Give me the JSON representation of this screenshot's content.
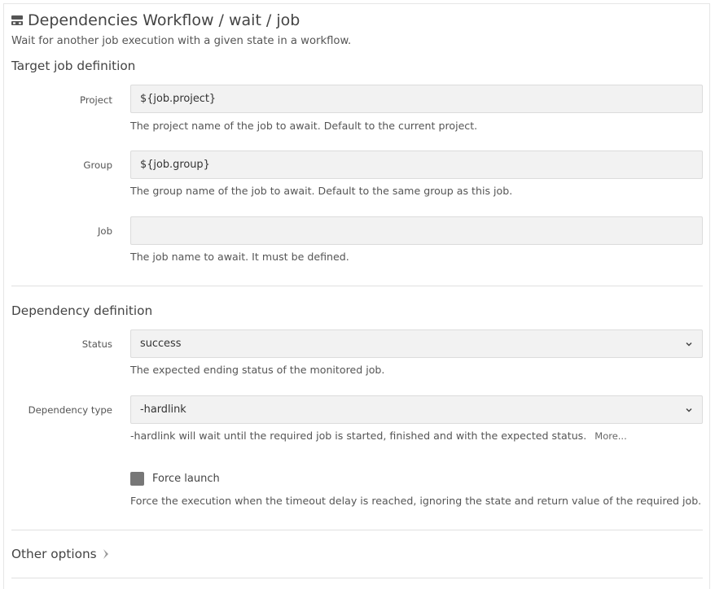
{
  "header": {
    "icon": "plugin-icon",
    "title": "Dependencies Workflow / wait / job",
    "subtitle": "Wait for another job execution with a given state in a workflow."
  },
  "target_section": {
    "heading": "Target job definition",
    "project": {
      "label": "Project",
      "value": "${job.project}",
      "help": "The project name of the job to await. Default to the current project."
    },
    "group": {
      "label": "Group",
      "value": "${job.group}",
      "help": "The group name of the job to await. Default to the same group as this job."
    },
    "job": {
      "label": "Job",
      "value": "",
      "help": "The job name to await. It must be defined."
    }
  },
  "dependency_section": {
    "heading": "Dependency definition",
    "status": {
      "label": "Status",
      "value": "success",
      "help": "The expected ending status of the monitored job."
    },
    "dependency_type": {
      "label": "Dependency type",
      "value": "-hardlink",
      "help": "-hardlink will wait until the required job is started, finished and with the expected status.",
      "more": "More..."
    },
    "force_launch": {
      "label": "Force launch",
      "checked": false,
      "help": "Force the execution when the timeout delay is reached, ignoring the state and return value of the required job."
    }
  },
  "other_options": {
    "label": "Other options",
    "icon": "chevron-right-icon"
  },
  "colors": {
    "field_bg": "#f2f2f2",
    "checkbox": "#777777",
    "divider": "#e0e0e0"
  }
}
